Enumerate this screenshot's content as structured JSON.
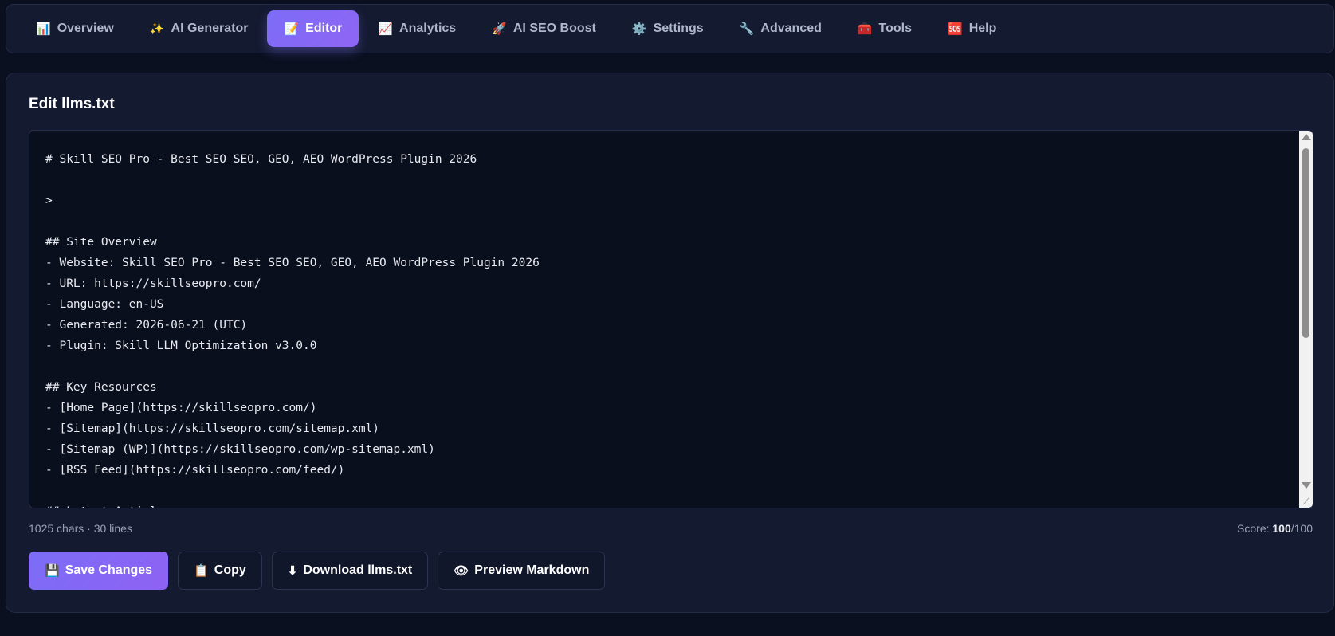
{
  "tabs": [
    {
      "icon": "📊",
      "label": "Overview",
      "active": false
    },
    {
      "icon": "✨",
      "label": "AI Generator",
      "active": false
    },
    {
      "icon": "📝",
      "label": "Editor",
      "active": true
    },
    {
      "icon": "📈",
      "label": "Analytics",
      "active": false
    },
    {
      "icon": "🚀",
      "label": "AI SEO Boost",
      "active": false
    },
    {
      "icon": "⚙️",
      "label": "Settings",
      "active": false
    },
    {
      "icon": "🔧",
      "label": "Advanced",
      "active": false
    },
    {
      "icon": "🧰",
      "label": "Tools",
      "active": false
    },
    {
      "icon": "🆘",
      "label": "Help",
      "active": false
    }
  ],
  "panel": {
    "title": "Edit llms.txt",
    "editor_content": "# Skill SEO Pro - Best SEO SEO, GEO, AEO WordPress Plugin 2026\n\n>\n\n## Site Overview\n- Website: Skill SEO Pro - Best SEO SEO, GEO, AEO WordPress Plugin 2026\n- URL: https://skillseopro.com/\n- Language: en-US\n- Generated: 2026-06-21 (UTC)\n- Plugin: Skill LLM Optimization v3.0.0\n\n## Key Resources\n- [Home Page](https://skillseopro.com/)\n- [Sitemap](https://skillseopro.com/sitemap.xml)\n- [Sitemap (WP)](https://skillseopro.com/wp-sitemap.xml)\n- [RSS Feed](https://skillseopro.com/feed/)\n\n## Latest Articles",
    "stats": "1025 chars · 30 lines",
    "score_label": "Score: ",
    "score_value": "100",
    "score_max": "/100"
  },
  "actions": {
    "save": {
      "icon": "💾",
      "label": "Save Changes"
    },
    "copy": {
      "icon": "📋",
      "label": "Copy"
    },
    "download": {
      "icon": "⬇",
      "label": "Download llms.txt"
    },
    "preview": {
      "icon": "👁",
      "label": "Preview Markdown"
    }
  }
}
